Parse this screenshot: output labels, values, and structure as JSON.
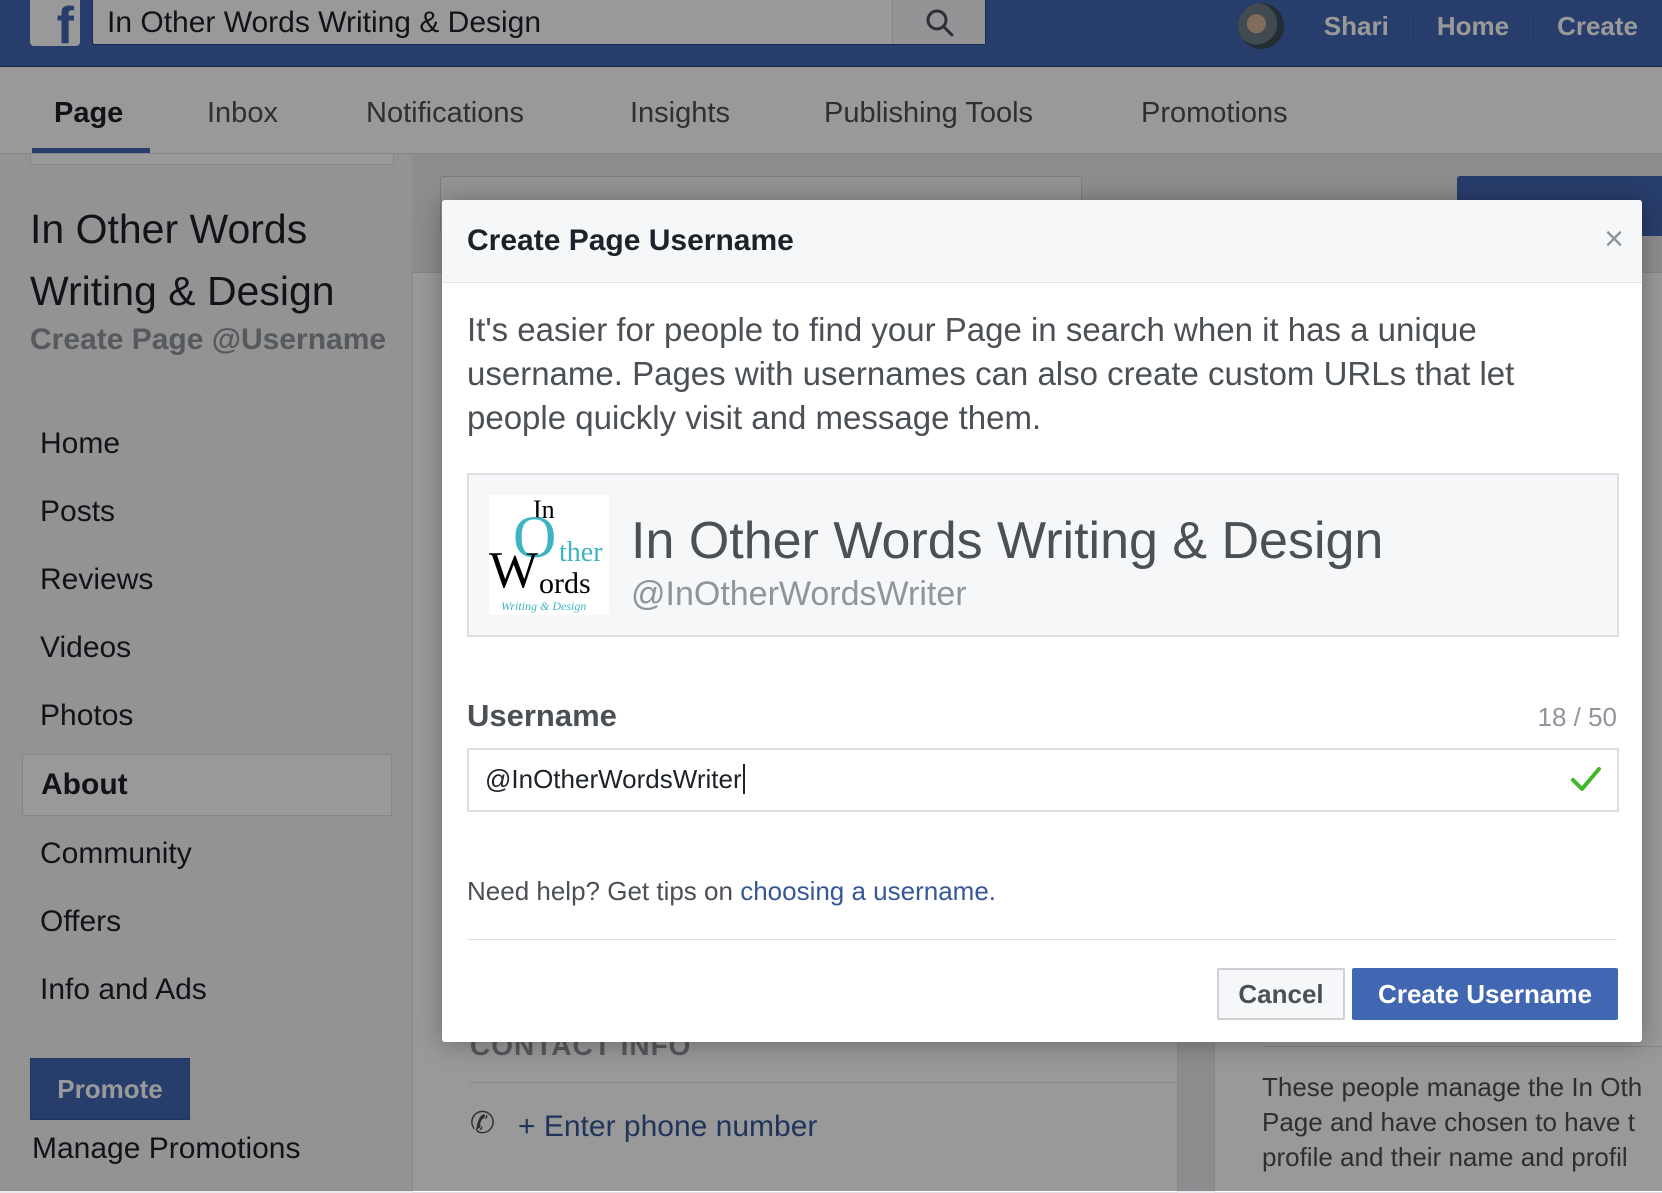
{
  "topbar": {
    "logo": "f",
    "search_value": "In Other Words Writing & Design",
    "user_name": "Shari",
    "links": [
      "Home",
      "Create"
    ]
  },
  "page_tabs": [
    "Page",
    "Inbox",
    "Notifications",
    "Insights",
    "Publishing Tools",
    "Promotions"
  ],
  "sidebar": {
    "page_name": "In Other Words Writing & Design",
    "create_username": "Create Page @Username",
    "nav": [
      "Home",
      "Posts",
      "Reviews",
      "Videos",
      "Photos",
      "About",
      "Community",
      "Offers",
      "Info and Ads"
    ],
    "active_nav": "About",
    "promote_label": "Promote",
    "manage_promotions": "Manage Promotions"
  },
  "main": {
    "contact_heading": "CONTACT INFO",
    "phone_link": "+ Enter phone number",
    "admins_text_lines": [
      "These people manage the In Oth",
      "Page and have chosen to have t",
      "profile and their name and profil"
    ]
  },
  "dialog": {
    "title": "Create Page Username",
    "close_label": "×",
    "description": "It's easier for people to find your Page in search when it has a unique username. Pages with usernames can also create custom URLs that let people quickly visit and message them.",
    "preview_name": "In Other Words Writing & Design",
    "preview_handle": "@InOtherWordsWriter",
    "logo_text": {
      "in": "In",
      "o": "O",
      "ther": "ther",
      "w": "W",
      "ords": "ords",
      "sub": "Writing & Design"
    },
    "username_label": "Username",
    "char_count": "18 / 50",
    "username_value": "@InOtherWordsWriter",
    "help_prefix": "Need help? Get tips on ",
    "help_link": "choosing a username.",
    "cancel_label": "Cancel",
    "create_label": "Create Username"
  },
  "colors": {
    "brand": "#4267b2",
    "link": "#365899",
    "valid_check": "#42b72a",
    "logo_teal": "#3db4c1"
  }
}
